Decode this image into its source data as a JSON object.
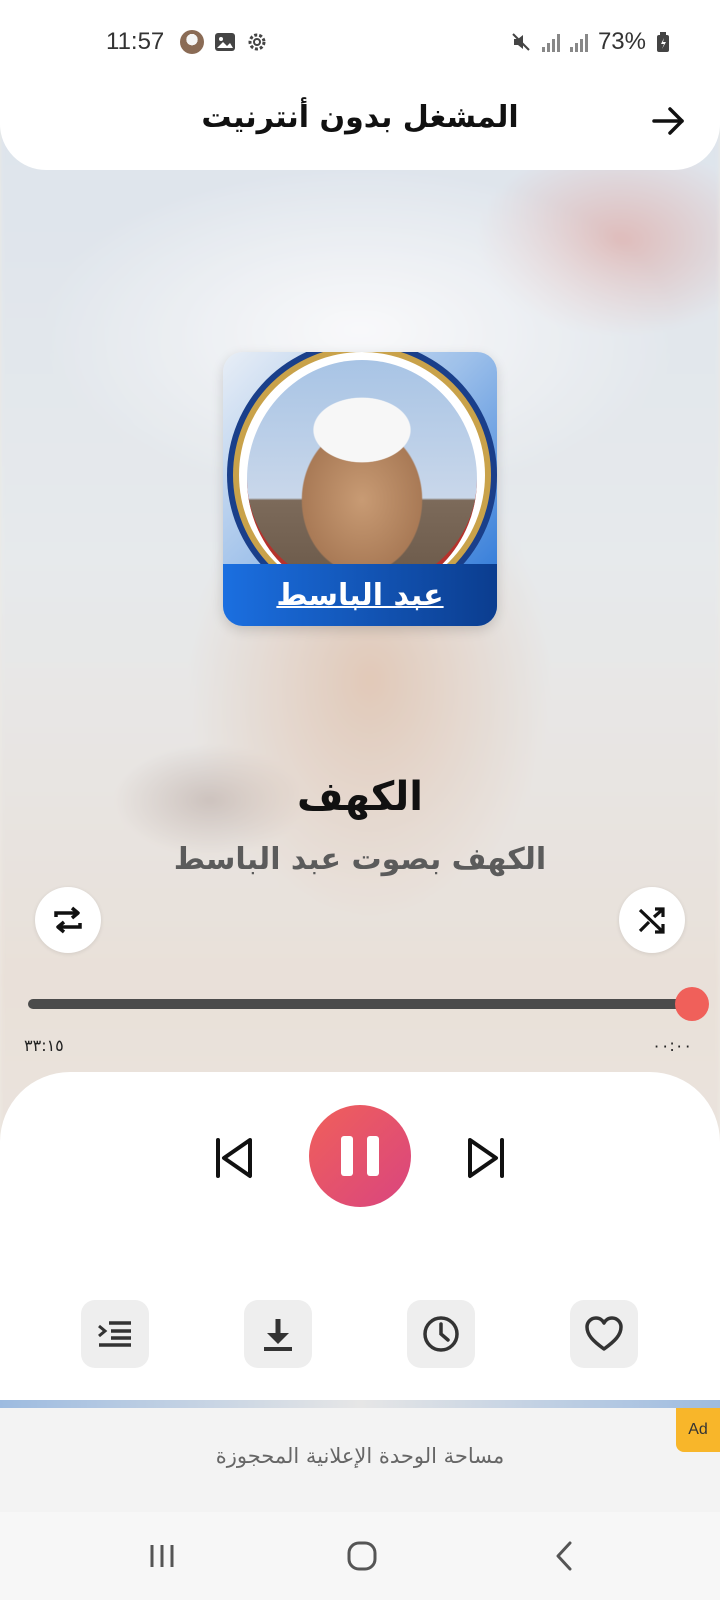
{
  "status_bar": {
    "time": "11:57",
    "battery": "73%",
    "icons": [
      "avatar-icon",
      "gallery-icon",
      "settings-icon",
      "mute-icon",
      "signal-icon",
      "signal-icon",
      "battery-icon"
    ]
  },
  "header": {
    "title": "المشغل بدون أنترنيت",
    "back_icon": "arrow-right-icon"
  },
  "album": {
    "name": "عبد الباسط"
  },
  "track": {
    "title": "الكهف",
    "subtitle": "الكهف بصوت عبد الباسط"
  },
  "player": {
    "elapsed": "٠٠:٠٠",
    "duration": "٣٣:١٥",
    "progress_fraction": 0.0,
    "repeat_icon": "repeat-icon",
    "shuffle_icon": "shuffle-icon",
    "state": "playing"
  },
  "actions": [
    {
      "name": "queue",
      "icon": "queue-list-icon"
    },
    {
      "name": "download",
      "icon": "download-icon"
    },
    {
      "name": "sleep-timer",
      "icon": "clock-icon"
    },
    {
      "name": "favorite",
      "icon": "heart-icon"
    }
  ],
  "ad": {
    "badge": "Ad",
    "text": "مساحة الوحدة الإعلانية المحجوزة"
  },
  "colors": {
    "accent": "#f0605a",
    "accent_end": "#d9457f",
    "ad_badge": "#f8b62a",
    "album_blue": "#1b6fe0"
  }
}
